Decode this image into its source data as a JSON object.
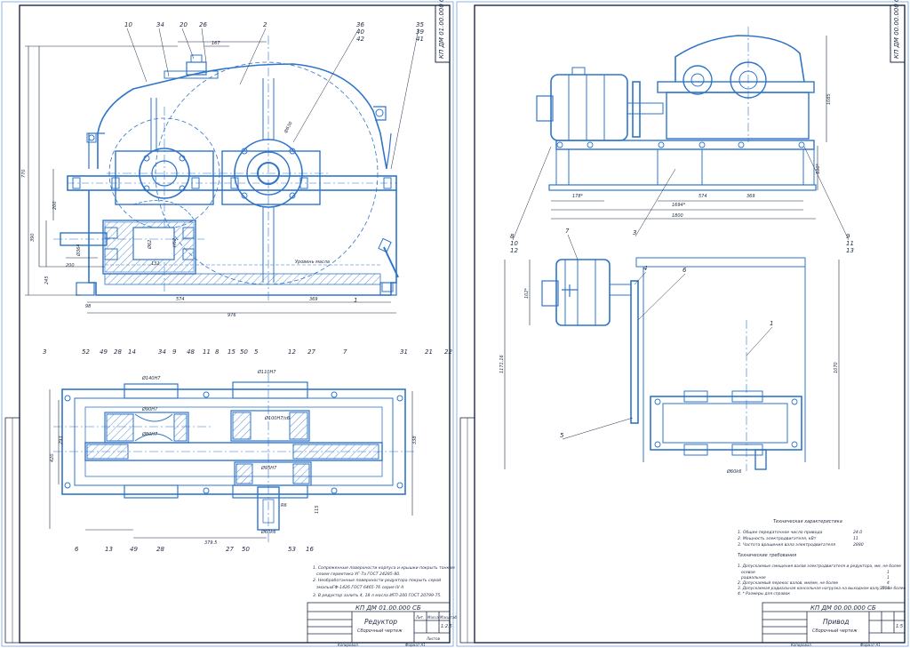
{
  "colors": {
    "line": "#2f74c9",
    "dark": "#1d2a44",
    "paper": "#ffffff"
  },
  "sheet1": {
    "code_rotated": "КП ДМ 01.00.000 СБ",
    "title_code": "КП ДМ 01.00.000 СБ",
    "title_name": "Редуктор",
    "title_sub": "Сборочный чертеж",
    "scale_label": "Масштаб",
    "scale": "1:2.5",
    "sheets_label": "Листов",
    "mass_label": "Масса",
    "col_lit": "Лит.",
    "copied": "Копировал",
    "format": "Формат   А1",
    "notes": [
      "1. Сопряженные поверхности корпуса и крышки покрыть тонким",
      "слоем герметика УГ-7а ГОСТ 24285-80.",
      "2. Необработанные поверхности редуктора покрыть серой",
      "эмалью",
      "3. В редуктор залить 4, 18 л масла ИГП-200 ГОСТ 20799-75."
    ],
    "enamel": "ГФ-1426 ГОСТ 6465-76 серия IV А",
    "callouts_top": [
      "10",
      "34",
      "20",
      "26",
      "2",
      "36",
      "40",
      "42",
      "35",
      "39",
      "41"
    ],
    "callouts_left": [
      "3",
      "52",
      "49",
      "28",
      "14",
      "34",
      "9",
      "48",
      "11",
      "8",
      "15",
      "50",
      "5",
      "12",
      "27",
      "7",
      "1",
      "31",
      "21",
      "22"
    ],
    "callouts_bottom": [
      "6",
      "13",
      "49",
      "28",
      "27",
      "50",
      "53",
      "16"
    ],
    "dims": [
      "167",
      "770",
      "200",
      "390",
      "245",
      "98",
      "574",
      "369",
      "976",
      "200",
      "Ø364",
      "Ø62",
      "132",
      "H52",
      "ф630",
      "Уровень масла",
      "420",
      "293",
      "338",
      "Ø140Н7",
      "Ø90Н7",
      "Ø110Н7",
      "Ø100Н7/s6",
      "Ø95Н7",
      "Ø80Н7",
      "Ø60k6",
      "379.5",
      "115",
      "R6"
    ]
  },
  "sheet2": {
    "code_rotated": "КП ДМ 00.00.000 СБ",
    "title_code": "КП ДМ 00.00.000 СБ",
    "title_name": "Привод",
    "title_sub": "Сборочный чертеж",
    "scale": "1:5",
    "copied": "Копировал",
    "format": "Формат   А1",
    "callouts": [
      "8",
      "10",
      "12",
      "3",
      "9",
      "11",
      "13",
      "7",
      "4",
      "6",
      "1",
      "5"
    ],
    "dims": [
      "178*",
      "574",
      "369",
      "1694*",
      "1800",
      "100*",
      "1085",
      "102*",
      "1171.16",
      "1070",
      "Ø60k6"
    ],
    "tech_heading": "Техническая характеристика",
    "tech_items": [
      "1. Общее передаточное число привода",
      "2. Мощность электродвигателя, кВт",
      "3. Частота вращения вала электродвигателя"
    ],
    "tech_values": [
      "24.0",
      "11",
      "2880"
    ],
    "req_heading": "Технические требования",
    "req_items": [
      "1. Допускаемые смещения валов электродвигателя и редуктора, мм, не более",
      "осевое",
      "радиальное",
      "2. Допускаемый перекос валов, мм/мм, не более",
      "3. Допускаемая радиальная консольная нагрузка на выходном валу, Н, не более",
      "4. * Размеры для справок"
    ],
    "req_values": [
      "",
      "1",
      "1",
      "4",
      "1500",
      ""
    ]
  }
}
